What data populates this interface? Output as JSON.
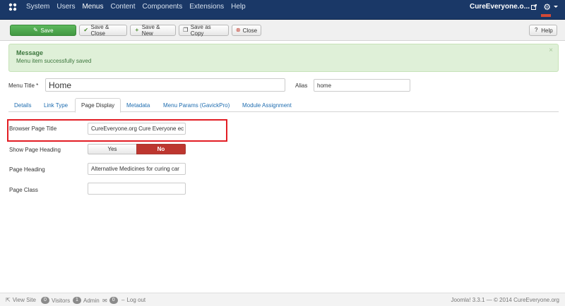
{
  "navbar": {
    "menu": [
      "System",
      "Users",
      "Menus",
      "Content",
      "Components",
      "Extensions",
      "Help"
    ],
    "site_name": "CureEveryone.o..."
  },
  "toolbar": {
    "save_label": "Save",
    "save_close_label": "Save & Close",
    "save_new_label": "Save & New",
    "save_copy_label": "Save as Copy",
    "close_label": "Close",
    "help_label": "Help"
  },
  "message": {
    "title": "Message",
    "text": "Menu item successfully saved"
  },
  "form": {
    "menu_title_label": "Menu Title *",
    "menu_title_value": "Home",
    "alias_label": "Alias",
    "alias_value": "home"
  },
  "tabs": [
    "Details",
    "Link Type",
    "Page Display",
    "Metadata",
    "Menu Params (GavickPro)",
    "Module Assignment"
  ],
  "active_tab": "Page Display",
  "page_display": {
    "browser_title_label": "Browser Page Title",
    "browser_title_value": "CureEveryone.org Cure Everyone ec",
    "show_heading_label": "Show Page Heading",
    "show_heading_yes": "Yes",
    "show_heading_no": "No",
    "show_heading_selected": "No",
    "page_heading_label": "Page Heading",
    "page_heading_value": "Alternative Medicines for curing car",
    "page_class_label": "Page Class",
    "page_class_value": ""
  },
  "footer": {
    "view_site": "View Site",
    "visitors_count": "0",
    "visitors_label": "Visitors",
    "admin_count": "1",
    "admin_label": "Admin",
    "messages_count": "0",
    "logout_label": "Log out",
    "copyright": "Joomla! 3.3.1  —  © 2014 CureEveryone.org"
  },
  "colors": {
    "navbar": "#1a3867",
    "save_green": "#5cb85c",
    "message_bg": "#dff0d8",
    "highlight_red": "#e21d24",
    "toggle_no": "#bd362f",
    "link_blue": "#1f6db0"
  }
}
